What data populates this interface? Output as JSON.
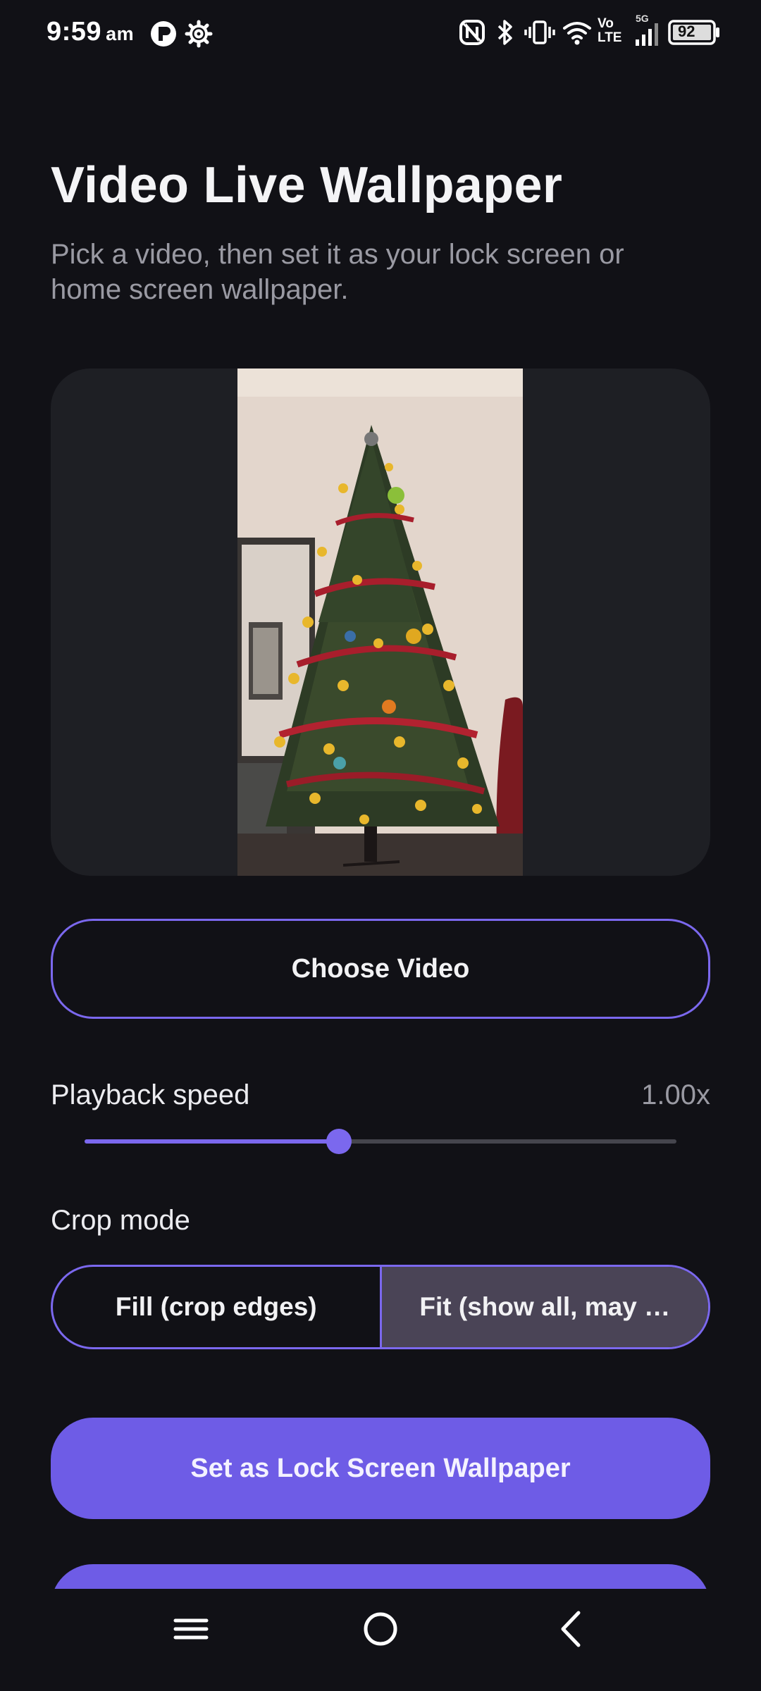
{
  "status_bar": {
    "time": "9:59",
    "ampm": "am",
    "battery": "92",
    "network_small": "5G",
    "volte_top": "Vo",
    "volte_bottom": "LTE"
  },
  "header": {
    "title": "Video Live Wallpaper",
    "subtitle": "Pick a video, then set it as your lock screen or home screen wallpaper."
  },
  "preview": {
    "description_icon": "video-preview-christmas-tree"
  },
  "choose_video": {
    "label": "Choose Video"
  },
  "playback": {
    "label": "Playback speed",
    "value_text": "1.00x",
    "slider_fraction": 0.43
  },
  "crop": {
    "label": "Crop mode",
    "options": [
      {
        "label": "Fill (crop edges)",
        "selected": false
      },
      {
        "label": "Fit (show all, may …",
        "selected": true
      }
    ]
  },
  "actions": {
    "lock_screen_label": "Set as Lock Screen Wallpaper",
    "home_screen_label": ""
  },
  "colors": {
    "background": "#111116",
    "accent": "#6e5ce6",
    "accent_border": "#7b68ee",
    "card": "#1e1f24",
    "muted_text": "#9a9aa3",
    "segment_selected": "#4a4456"
  }
}
